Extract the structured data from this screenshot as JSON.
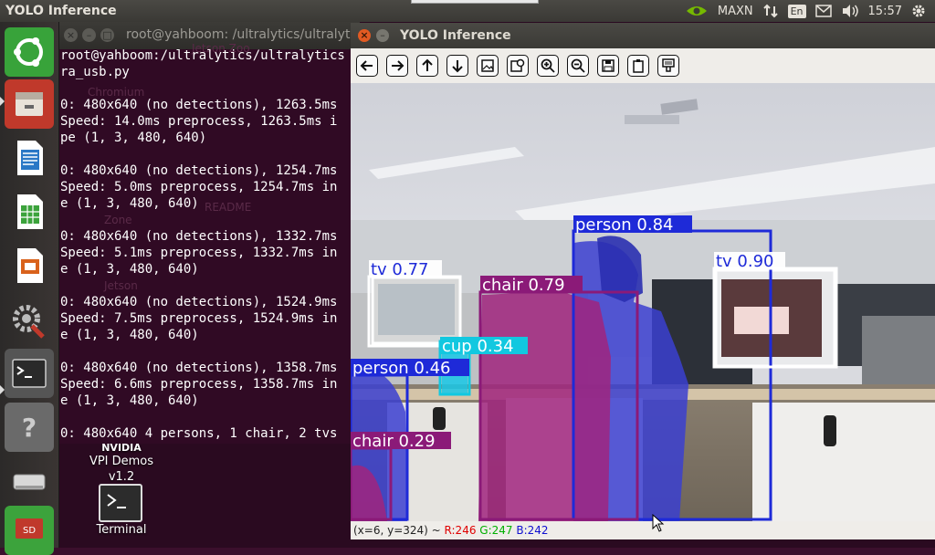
{
  "top_panel": {
    "app_title": "YOLO Inference",
    "power_mode": "MAXN",
    "keyboard_layout": "En",
    "clock": "15:57"
  },
  "launcher": {
    "items": [
      "ubuntu-dash",
      "file-manager",
      "writer",
      "calc",
      "impress",
      "system-settings",
      "terminal",
      "help",
      "drive",
      "sd-card"
    ]
  },
  "terminal": {
    "title": "root@yahboom: /ultralytics/ultralytics",
    "lines": [
      "root@yahboom:/ultralytics/ultralytics",
      "ra_usb.py",
      "",
      "0: 480x640 (no detections), 1263.5ms",
      "Speed: 14.0ms preprocess, 1263.5ms i",
      "pe (1, 3, 480, 640)",
      "",
      "0: 480x640 (no detections), 1254.7ms",
      "Speed: 5.0ms preprocess, 1254.7ms in",
      "e (1, 3, 480, 640)",
      "",
      "0: 480x640 (no detections), 1332.7ms",
      "Speed: 5.1ms preprocess, 1332.7ms in",
      "e (1, 3, 480, 640)",
      "",
      "0: 480x640 (no detections), 1524.9ms",
      "Speed: 7.5ms preprocess, 1524.9ms in",
      "e (1, 3, 480, 640)",
      "",
      "0: 480x640 (no detections), 1358.7ms",
      "Speed: 6.6ms preprocess, 1358.7ms in",
      "e (1, 3, 480, 640)",
      "",
      "0: 480x640 4 persons, 1 chair, 2 tvs"
    ]
  },
  "desktop": {
    "vpi_brand": "NVIDIA",
    "vpi_label": "VPI Demos",
    "vpi_version": "v1.2",
    "terminal_label": "Terminal",
    "ghost_labels": [
      "Chromium",
      "Jetson Zoo",
      "README",
      "Zone",
      "Jetson"
    ]
  },
  "yolo_window": {
    "title": "YOLO Inference",
    "toolbar": [
      "pan-left",
      "pan-right",
      "pan-up",
      "pan-down",
      "fit-image",
      "zoom-to-region",
      "zoom-in",
      "zoom-out",
      "save",
      "copy",
      "properties"
    ],
    "detections": [
      {
        "label": "person 0.84",
        "class": "person",
        "color": "#1e2ad8"
      },
      {
        "label": "tv 0.90",
        "class": "tv",
        "color": "#1e2ad8"
      },
      {
        "label": "tv 0.77",
        "class": "tv",
        "color": "#1e2ad8"
      },
      {
        "label": "chair 0.79",
        "class": "chair",
        "color": "#8b1a78"
      },
      {
        "label": "cup 0.34",
        "class": "cup",
        "color": "#12c8e0"
      },
      {
        "label": "person 0.46",
        "class": "person",
        "color": "#1e2ad8"
      },
      {
        "label": "chair 0.29",
        "class": "chair",
        "color": "#8b1a78"
      }
    ],
    "status": {
      "coords": "(x=6, y=324) ~",
      "r": "R:246",
      "g": "G:247",
      "b": "B:242"
    }
  }
}
